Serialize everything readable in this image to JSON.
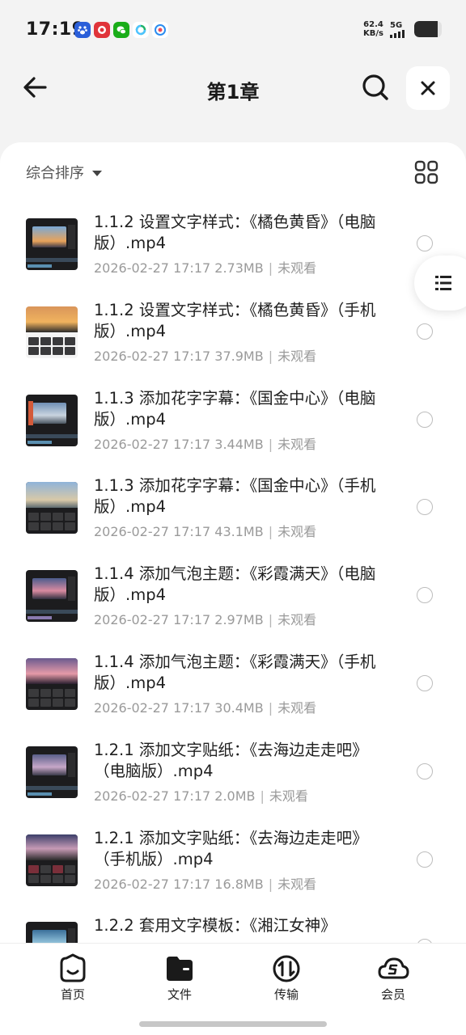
{
  "status_bar": {
    "time": "17:19",
    "net_speed_value": "62.4",
    "net_speed_unit": "KB/s",
    "network": "5G",
    "battery_percent": 85,
    "apps": [
      "baidu-app-icon",
      "game-app-icon",
      "wechat-app-icon",
      "green-app-icon",
      "cloud-app-icon"
    ]
  },
  "header": {
    "title": "第1章"
  },
  "toolbar": {
    "sort_label": "综合排序"
  },
  "files": [
    {
      "title": "1.1.2  设置文字样式：《橘色黄昏》（电脑版）.mp4",
      "date": "2026-02-27 17:17",
      "size": "2.73MB",
      "status": "未观看",
      "sep": "|"
    },
    {
      "title": "1.1.2  设置文字样式：《橘色黄昏》（手机版）.mp4",
      "date": "2026-02-27 17:17",
      "size": "37.9MB",
      "status": "未观看",
      "sep": "|"
    },
    {
      "title": "1.1.3  添加花字字幕：《国金中心》（电脑版）.mp4",
      "date": "2026-02-27 17:17",
      "size": "3.44MB",
      "status": "未观看",
      "sep": "|"
    },
    {
      "title": "1.1.3  添加花字字幕：《国金中心》（手机版）.mp4",
      "date": "2026-02-27 17:17",
      "size": "43.1MB",
      "status": "未观看",
      "sep": "|"
    },
    {
      "title": "1.1.4  添加气泡主题：《彩霞满天》（电脑版）.mp4",
      "date": "2026-02-27 17:17",
      "size": "2.97MB",
      "status": "未观看",
      "sep": "|"
    },
    {
      "title": "1.1.4  添加气泡主题：《彩霞满天》（手机版）.mp4",
      "date": "2026-02-27 17:17",
      "size": "30.4MB",
      "status": "未观看",
      "sep": "|"
    },
    {
      "title": "1.2.1  添加文字贴纸：《去海边走走吧》（电脑版）.mp4",
      "date": "2026-02-27 17:17",
      "size": "2.0MB",
      "status": "未观看",
      "sep": "|"
    },
    {
      "title": "1.2.1  添加文字贴纸：《去海边走走吧》（手机版）.mp4",
      "date": "2026-02-27 17:17",
      "size": "16.8MB",
      "status": "未观看",
      "sep": "|"
    },
    {
      "title": "1.2.2  套用文字模板：《湘江女神》",
      "date": "",
      "size": "",
      "status": "",
      "sep": ""
    }
  ],
  "nav": {
    "home": "首页",
    "files": "文件",
    "transfer": "传输",
    "member": "会员"
  },
  "colors": {
    "accent": "#1f1f1f",
    "meta_text": "#9a9a9a",
    "background": "#f3f3f3"
  }
}
